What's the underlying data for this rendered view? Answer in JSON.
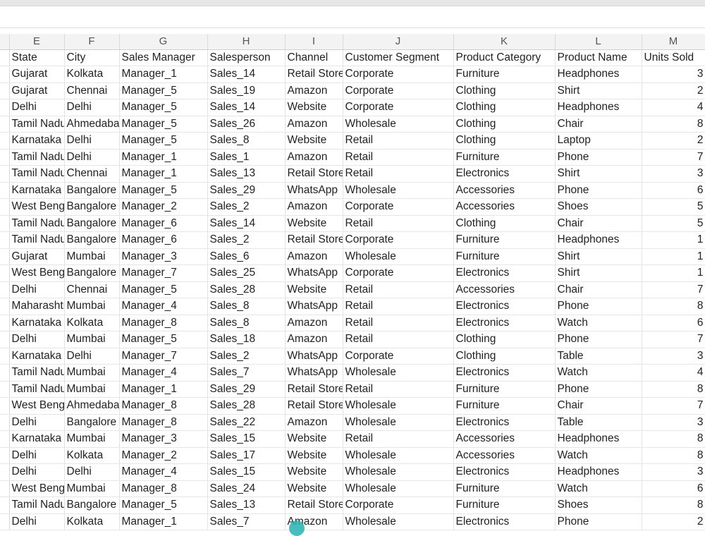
{
  "columns": [
    "E",
    "F",
    "G",
    "H",
    "I",
    "J",
    "K",
    "L",
    "M"
  ],
  "headers": [
    "State",
    "City",
    "Sales Manager",
    "Salesperson",
    "Channel",
    "Customer Segment",
    "Product Category",
    "Product Name",
    "Units Sold"
  ],
  "rows": [
    [
      "Gujarat",
      "Kolkata",
      "Manager_1",
      "Sales_14",
      "Retail Store",
      "Corporate",
      "Furniture",
      "Headphones",
      "3"
    ],
    [
      "Gujarat",
      "Chennai",
      "Manager_5",
      "Sales_19",
      "Amazon",
      "Corporate",
      "Clothing",
      "Shirt",
      "2"
    ],
    [
      "Delhi",
      "Delhi",
      "Manager_5",
      "Sales_14",
      "Website",
      "Corporate",
      "Clothing",
      "Headphones",
      "4"
    ],
    [
      "Tamil Nadu",
      "Ahmedabad",
      "Manager_5",
      "Sales_26",
      "Amazon",
      "Wholesale",
      "Clothing",
      "Chair",
      "8"
    ],
    [
      "Karnataka",
      "Delhi",
      "Manager_5",
      "Sales_8",
      "Website",
      "Retail",
      "Clothing",
      "Laptop",
      "2"
    ],
    [
      "Tamil Nadu",
      "Delhi",
      "Manager_1",
      "Sales_1",
      "Amazon",
      "Retail",
      "Furniture",
      "Phone",
      "7"
    ],
    [
      "Tamil Nadu",
      "Chennai",
      "Manager_1",
      "Sales_13",
      "Retail Store",
      "Retail",
      "Electronics",
      "Shirt",
      "3"
    ],
    [
      "Karnataka",
      "Bangalore",
      "Manager_5",
      "Sales_29",
      "WhatsApp",
      "Wholesale",
      "Accessories",
      "Phone",
      "6"
    ],
    [
      "West Bengal",
      "Bangalore",
      "Manager_2",
      "Sales_2",
      "Amazon",
      "Corporate",
      "Accessories",
      "Shoes",
      "5"
    ],
    [
      "Tamil Nadu",
      "Bangalore",
      "Manager_6",
      "Sales_14",
      "Website",
      "Retail",
      "Clothing",
      "Chair",
      "5"
    ],
    [
      "Tamil Nadu",
      "Bangalore",
      "Manager_6",
      "Sales_2",
      "Retail Store",
      "Corporate",
      "Furniture",
      "Headphones",
      "1"
    ],
    [
      "Gujarat",
      "Mumbai",
      "Manager_3",
      "Sales_6",
      "Amazon",
      "Wholesale",
      "Furniture",
      "Shirt",
      "1"
    ],
    [
      "West Bengal",
      "Bangalore",
      "Manager_7",
      "Sales_25",
      "WhatsApp",
      "Corporate",
      "Electronics",
      "Shirt",
      "1"
    ],
    [
      "Delhi",
      "Chennai",
      "Manager_5",
      "Sales_28",
      "Website",
      "Retail",
      "Accessories",
      "Chair",
      "7"
    ],
    [
      "Maharashtra",
      "Mumbai",
      "Manager_4",
      "Sales_8",
      "WhatsApp",
      "Retail",
      "Electronics",
      "Phone",
      "8"
    ],
    [
      "Karnataka",
      "Kolkata",
      "Manager_8",
      "Sales_8",
      "Amazon",
      "Retail",
      "Electronics",
      "Watch",
      "6"
    ],
    [
      "Delhi",
      "Mumbai",
      "Manager_5",
      "Sales_18",
      "Amazon",
      "Retail",
      "Clothing",
      "Phone",
      "7"
    ],
    [
      "Karnataka",
      "Delhi",
      "Manager_7",
      "Sales_2",
      "WhatsApp",
      "Corporate",
      "Clothing",
      "Table",
      "3"
    ],
    [
      "Tamil Nadu",
      "Mumbai",
      "Manager_4",
      "Sales_7",
      "WhatsApp",
      "Wholesale",
      "Electronics",
      "Watch",
      "4"
    ],
    [
      "Tamil Nadu",
      "Mumbai",
      "Manager_1",
      "Sales_29",
      "Retail Store",
      "Retail",
      "Furniture",
      "Phone",
      "8"
    ],
    [
      "West Bengal",
      "Ahmedabad",
      "Manager_8",
      "Sales_28",
      "Retail Store",
      "Wholesale",
      "Furniture",
      "Chair",
      "7"
    ],
    [
      "Delhi",
      "Bangalore",
      "Manager_8",
      "Sales_22",
      "Amazon",
      "Wholesale",
      "Electronics",
      "Table",
      "3"
    ],
    [
      "Karnataka",
      "Mumbai",
      "Manager_3",
      "Sales_15",
      "Website",
      "Retail",
      "Accessories",
      "Headphones",
      "8"
    ],
    [
      "Delhi",
      "Kolkata",
      "Manager_2",
      "Sales_17",
      "Website",
      "Wholesale",
      "Accessories",
      "Watch",
      "8"
    ],
    [
      "Delhi",
      "Delhi",
      "Manager_4",
      "Sales_15",
      "Website",
      "Wholesale",
      "Electronics",
      "Headphones",
      "3"
    ],
    [
      "West Bengal",
      "Mumbai",
      "Manager_8",
      "Sales_24",
      "Website",
      "Wholesale",
      "Furniture",
      "Watch",
      "6"
    ],
    [
      "Tamil Nadu",
      "Bangalore",
      "Manager_5",
      "Sales_13",
      "Retail Store",
      "Corporate",
      "Furniture",
      "Shoes",
      "8"
    ],
    [
      "Delhi",
      "Kolkata",
      "Manager_1",
      "Sales_7",
      "Amazon",
      "Wholesale",
      "Electronics",
      "Phone",
      "2"
    ]
  ]
}
